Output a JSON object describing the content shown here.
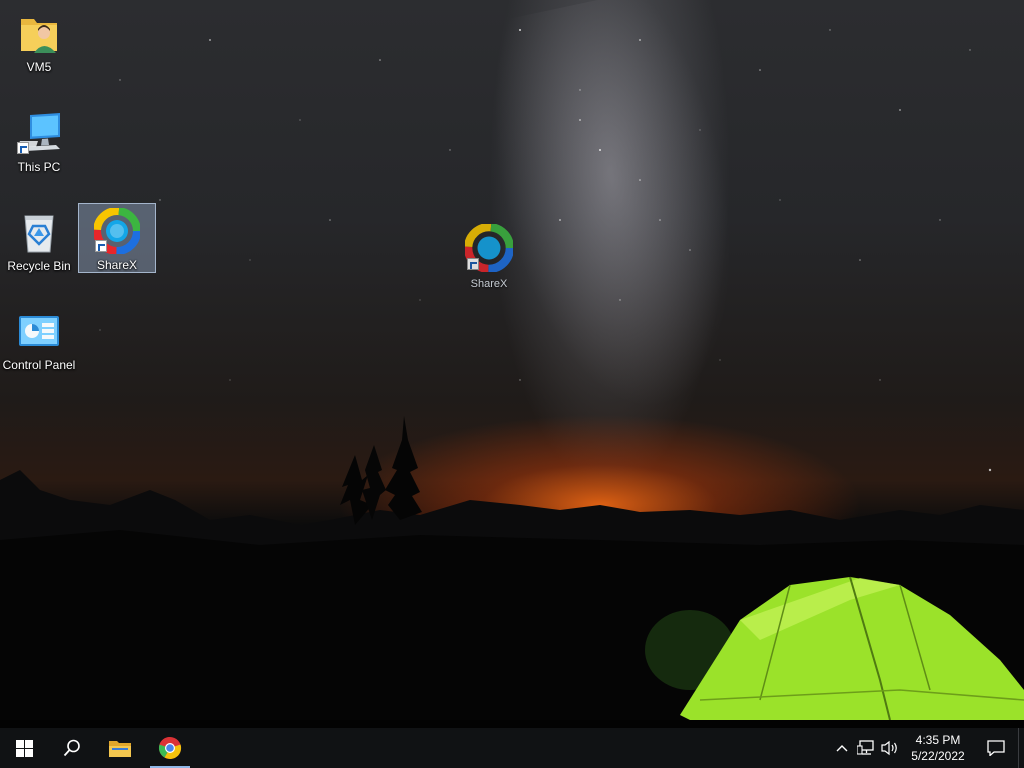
{
  "desktop": {
    "icons": [
      {
        "id": "vm5",
        "label": "VM5",
        "icon": "user-folder-icon"
      },
      {
        "id": "this-pc",
        "label": "This PC",
        "icon": "computer-icon"
      },
      {
        "id": "recycle-bin",
        "label": "Recycle Bin",
        "icon": "recycle-bin-icon"
      },
      {
        "id": "sharex-selected",
        "label": "ShareX",
        "icon": "sharex-icon"
      },
      {
        "id": "control-panel",
        "label": "Control Panel",
        "icon": "control-panel-icon"
      }
    ],
    "drag_ghost": {
      "label": "ShareX",
      "icon": "sharex-icon"
    }
  },
  "taskbar": {
    "start": "windows-start-icon",
    "search": "search-icon",
    "pinned": [
      {
        "id": "file-explorer",
        "icon": "folder-icon",
        "running": false
      },
      {
        "id": "chrome",
        "icon": "chrome-icon",
        "running": true
      }
    ],
    "tray": {
      "icons": [
        "chevron-up-icon",
        "network-icon",
        "volume-icon"
      ],
      "time": "4:35 PM",
      "date": "5/22/2022",
      "notification_icon": "notification-icon"
    }
  },
  "colors": {
    "taskbar_bg": "#101214",
    "selection": "#96aac8",
    "running_indicator": "#8fb7e8",
    "tent_green": "#9be22a"
  }
}
